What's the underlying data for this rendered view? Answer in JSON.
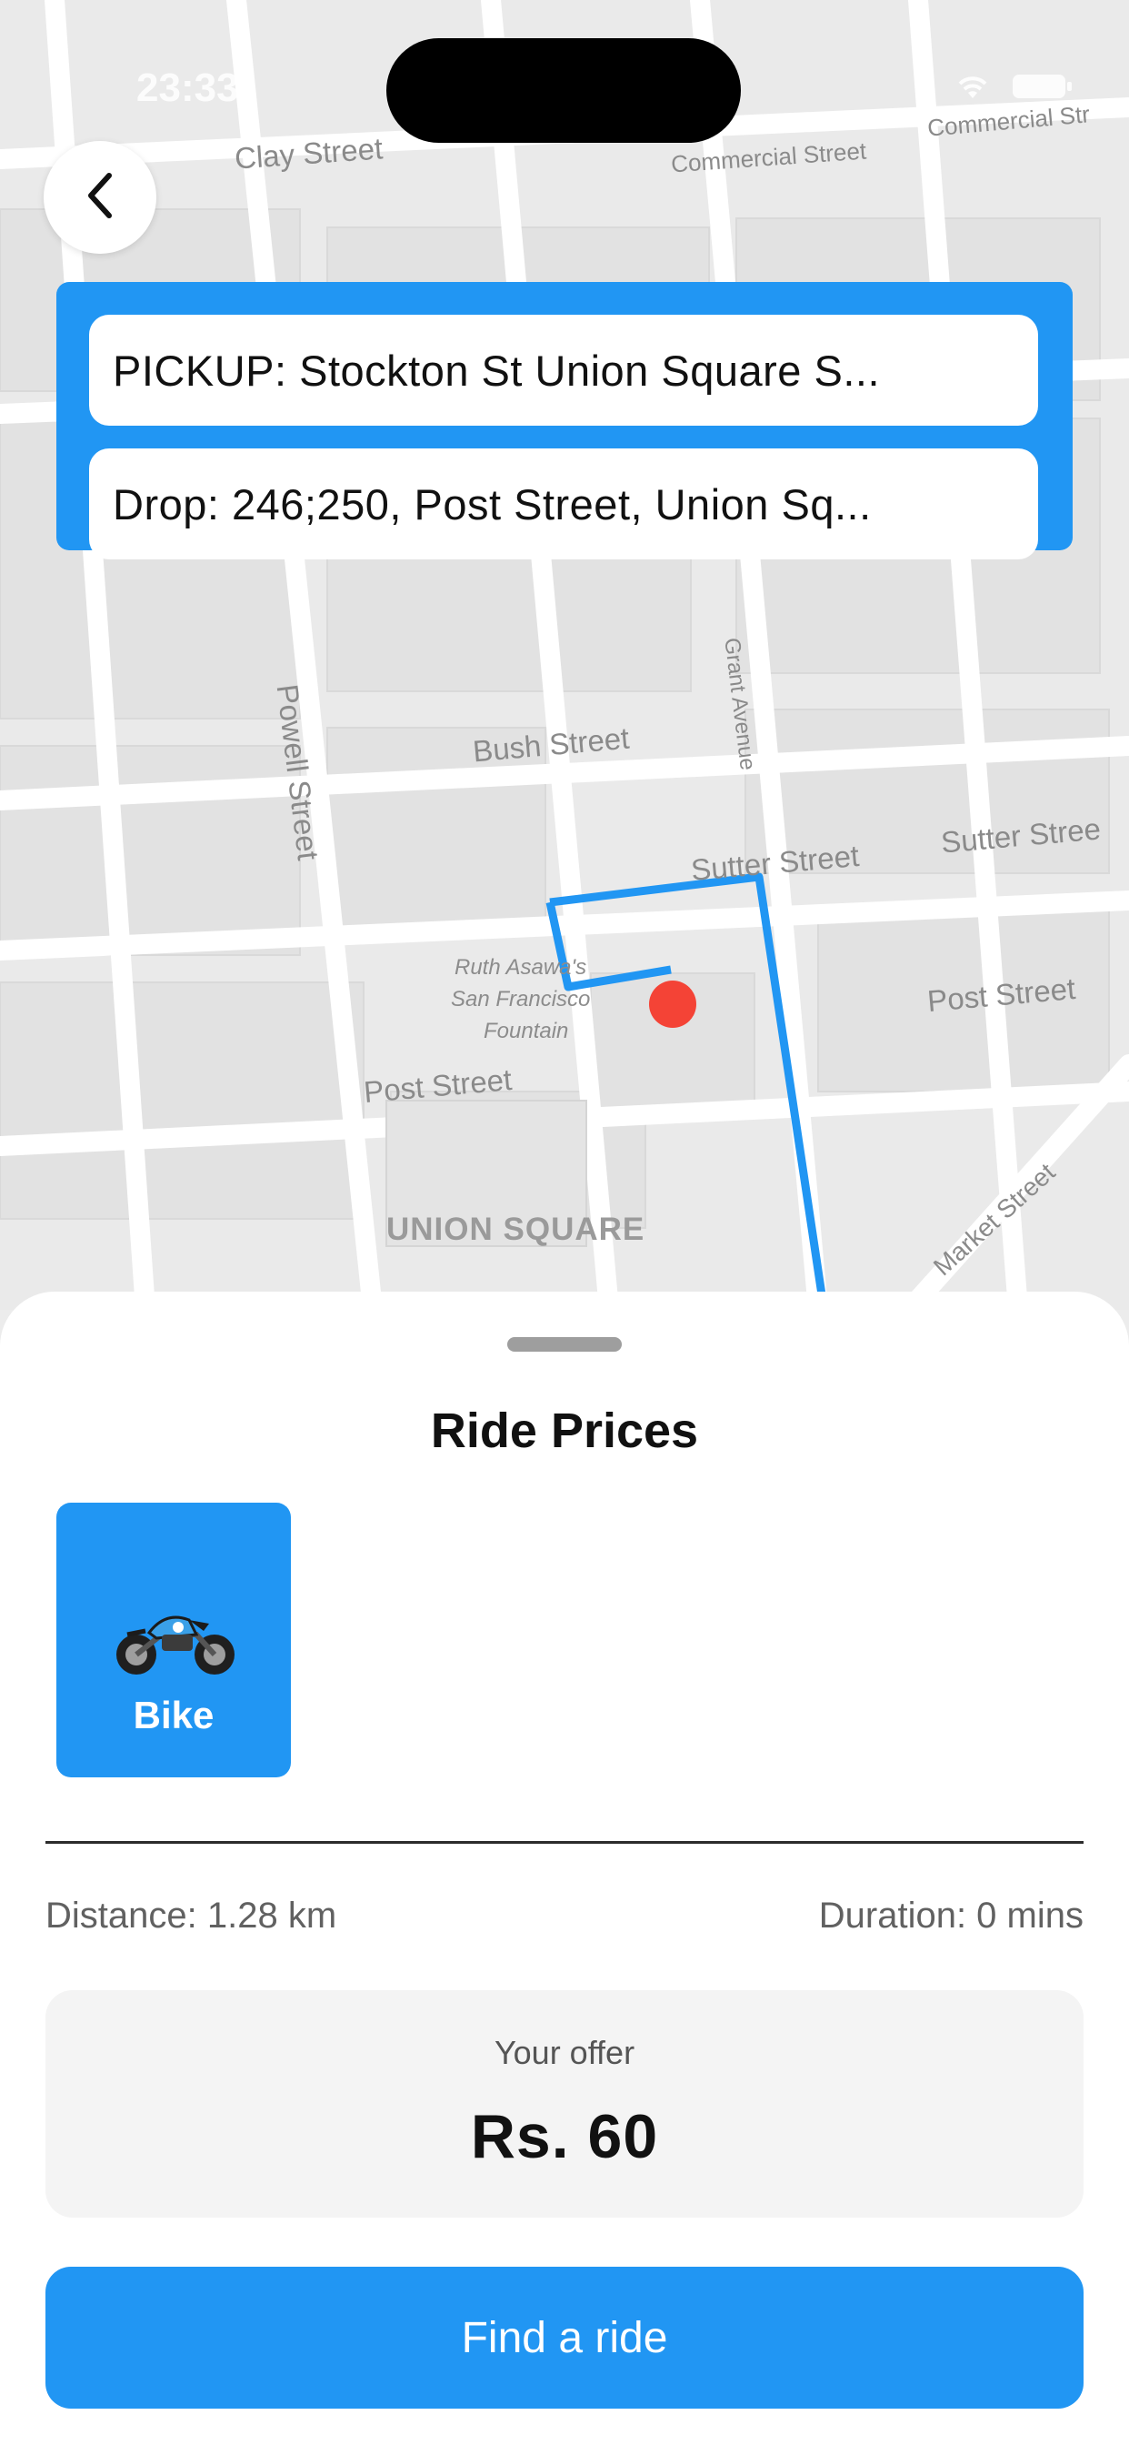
{
  "status_bar": {
    "time": "23:33"
  },
  "map": {
    "streets": {
      "clay": "Clay Street",
      "commercial1": "Commercial Street",
      "commercial2": "Commercial Str",
      "bush": "Bush Street",
      "sutter": "Sutter Street",
      "sutter2": "Sutter Stree",
      "post": "Post Street",
      "post2": "Post Street",
      "powell": "Powell Street",
      "grant": "Grant Avenue",
      "market": "Market Street",
      "union_square": "UNION SQUARE",
      "fountain1": "Ruth Asawa's",
      "fountain2": "San Francisco",
      "fountain3": "Fountain"
    },
    "route_color": "#2196F3",
    "marker_color": "#F44336"
  },
  "route": {
    "pickup": "PICKUP: Stockton St Union Square S...",
    "drop": "Drop: 246;250, Post Street, Union Sq..."
  },
  "sheet": {
    "title": "Ride Prices",
    "vehicles": [
      {
        "label": "Bike",
        "icon": "motorcycle-icon",
        "selected": true
      }
    ],
    "distance": "Distance: 1.28 km",
    "duration": "Duration: 0 mins",
    "offer_label": "Your offer",
    "offer_value": "Rs. 60",
    "button_label": "Find a ride"
  },
  "colors": {
    "accent": "#2196F3"
  }
}
